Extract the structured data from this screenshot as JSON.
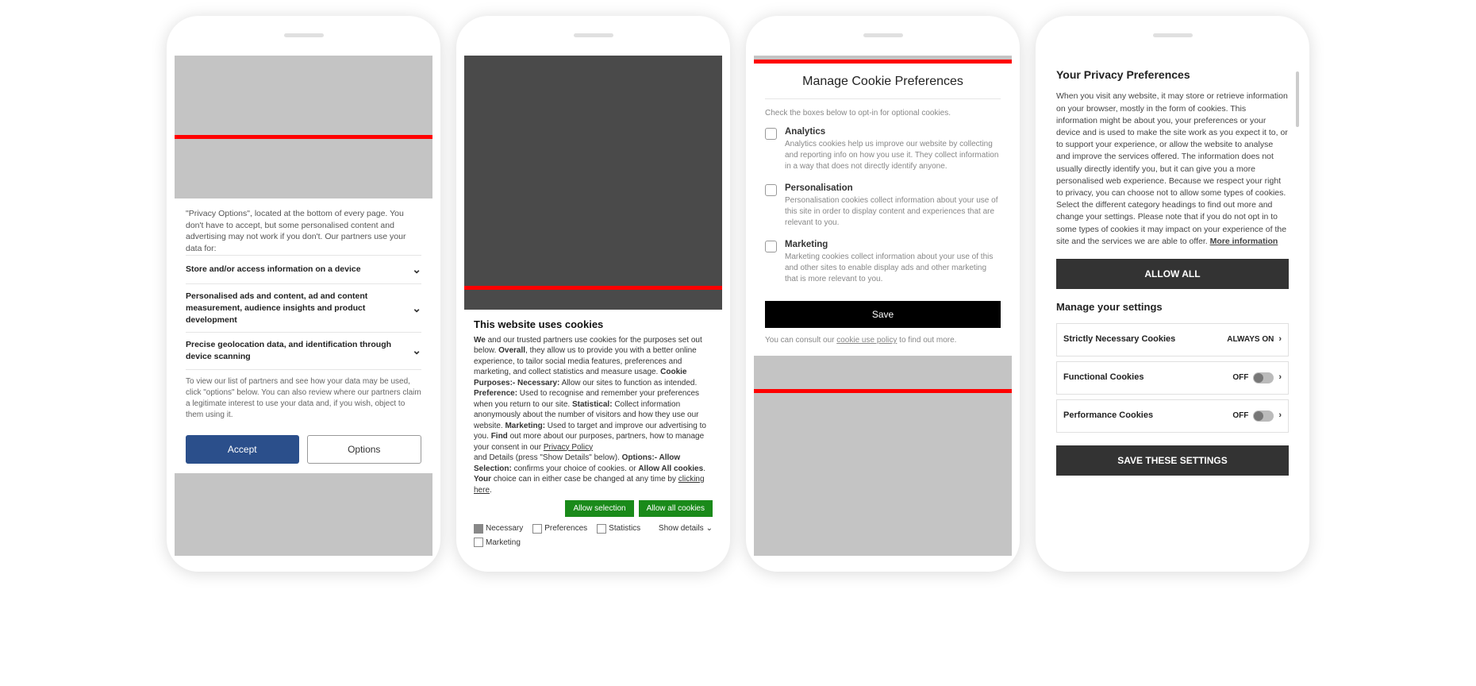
{
  "phone1": {
    "intro": "\"Privacy Options\", located at the bottom of every page. You don't have to accept, but some personalised content and advertising may not work if you don't. Our partners use your data for:",
    "rows": [
      "Store and/or access information on a device",
      "Personalised ads and content, ad and content measurement, audience insights and product development",
      "Precise geolocation data, and identification through device scanning"
    ],
    "footer": "To view our list of partners and see how your data may be used, click \"options\" below. You can also review where our partners claim a legitimate interest to use your data and, if you wish, object to them using it.",
    "accept": "Accept",
    "options": "Options"
  },
  "phone2": {
    "title": "This website uses cookies",
    "body_parts": {
      "t1": "We",
      "t2": " and our trusted partners use cookies for the purposes set out below. ",
      "t3": "Overall",
      "t4": ", they allow us to provide you with a better online experience, to tailor social media features, preferences and marketing, and collect statistics and measure usage. ",
      "t5": "Cookie Purposes:- Necessary:",
      "t6": " Allow our sites to function as intended. ",
      "t7": "Preference:",
      "t8": " Used to recognise and remember your preferences when you return to our site. ",
      "t9": "Statistical:",
      "t10": " Collect information anonymously about the number of visitors and how they use our website. ",
      "t11": "Marketing:",
      "t12": " Used to target and improve our advertising to you. ",
      "t13": "Find",
      "t14": " out more about our purposes, partners, how to manage your consent in our ",
      "t15": "Privacy Policy",
      "t16": "and Details (press \"Show Details\" below). ",
      "t17": "Options:- Allow Selection:",
      "t18": " confirms your choice of cookies. or ",
      "t19": "Allow All cookies",
      "t20": ". ",
      "t21": "Your",
      "t22": " choice can in either case be changed at any time by ",
      "t23": "clicking here",
      "t24": "."
    },
    "allow_selection": "Allow selection",
    "allow_all": "Allow all cookies",
    "checks": {
      "necessary": "Necessary",
      "preferences": "Preferences",
      "statistics": "Statistics",
      "marketing": "Marketing"
    },
    "show_details": "Show details"
  },
  "phone3": {
    "title": "Manage Cookie Preferences",
    "sub": "Check the boxes below to opt-in for optional cookies.",
    "items": [
      {
        "head": "Analytics",
        "desc": "Analytics cookies help us improve our website by collecting and reporting info on how you use it. They collect information in a way that does not directly identify anyone."
      },
      {
        "head": "Personalisation",
        "desc": "Personalisation cookies collect information about your use of this site in order to display content and experiences that are relevant to you."
      },
      {
        "head": "Marketing",
        "desc": "Marketing cookies collect information about your use of this and other sites to enable display ads and other marketing that is more relevant to you."
      }
    ],
    "save": "Save",
    "foot1": "You can consult our ",
    "foot_link": "cookie use policy",
    "foot2": " to find out more."
  },
  "phone4": {
    "title": "Your Privacy Preferences",
    "body": "When you visit any website, it may store or retrieve information on your browser, mostly in the form of cookies. This information might be about you, your preferences or your device and is used to make the site work as you expect it to, or to support your experience, or allow the website to analyse and improve the services offered. The information does not usually directly identify you, but it can give you a more personalised web experience. Because we respect your right to privacy, you can choose not to allow some types of cookies. Select the different category headings to find out more and change your settings. Please note that if you do not opt in to some types of cookies it may impact on your experience of the site and the services we are able to offer.  ",
    "more": "More information",
    "allow_all": "ALLOW ALL",
    "manage": "Manage your settings",
    "settings": [
      {
        "label": "Strictly Necessary Cookies",
        "state": "ALWAYS ON",
        "toggle": false
      },
      {
        "label": "Functional Cookies",
        "state": "OFF",
        "toggle": true
      },
      {
        "label": "Performance Cookies",
        "state": "OFF",
        "toggle": true
      }
    ],
    "save": "SAVE THESE SETTINGS"
  }
}
